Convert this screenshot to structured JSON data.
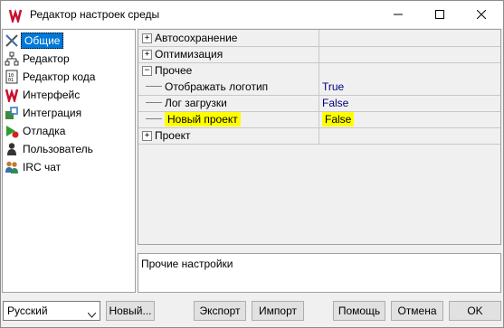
{
  "window": {
    "title": "Редактор настроек среды"
  },
  "sidebar": {
    "items": [
      {
        "label": "Общие",
        "icon": "tools-icon",
        "selected": true
      },
      {
        "label": "Редактор",
        "icon": "tree-icon"
      },
      {
        "label": "Редактор кода",
        "icon": "code-icon"
      },
      {
        "label": "Интерфейс",
        "icon": "app-logo-icon"
      },
      {
        "label": "Интеграция",
        "icon": "integration-icon"
      },
      {
        "label": "Отладка",
        "icon": "debug-icon"
      },
      {
        "label": "Пользователь",
        "icon": "user-icon"
      },
      {
        "label": "IRC чат",
        "icon": "users-icon"
      }
    ]
  },
  "grid": {
    "rows": [
      {
        "name": "Автосохранение",
        "type": "category",
        "expanded": false
      },
      {
        "name": "Оптимизация",
        "type": "category",
        "expanded": false
      },
      {
        "name": "Прочее",
        "type": "category",
        "expanded": true
      },
      {
        "name": "Отображать логотип",
        "value": "True",
        "type": "property"
      },
      {
        "name": "Лог загрузки",
        "value": "False",
        "type": "property"
      },
      {
        "name": "Новый проект",
        "value": "False",
        "type": "property",
        "highlighted": true
      },
      {
        "name": "Проект",
        "type": "category",
        "expanded": false
      }
    ]
  },
  "description": {
    "text": "Прочие настройки"
  },
  "footer": {
    "language": "Русский",
    "new_label": "Новый...",
    "export_label": "Экспорт",
    "import_label": "Импорт",
    "help_label": "Помощь",
    "cancel_label": "Отмена",
    "ok_label": "OK"
  },
  "colors": {
    "selection": "#0078d7",
    "highlight": "#ffff00",
    "value_text": "#000080"
  }
}
